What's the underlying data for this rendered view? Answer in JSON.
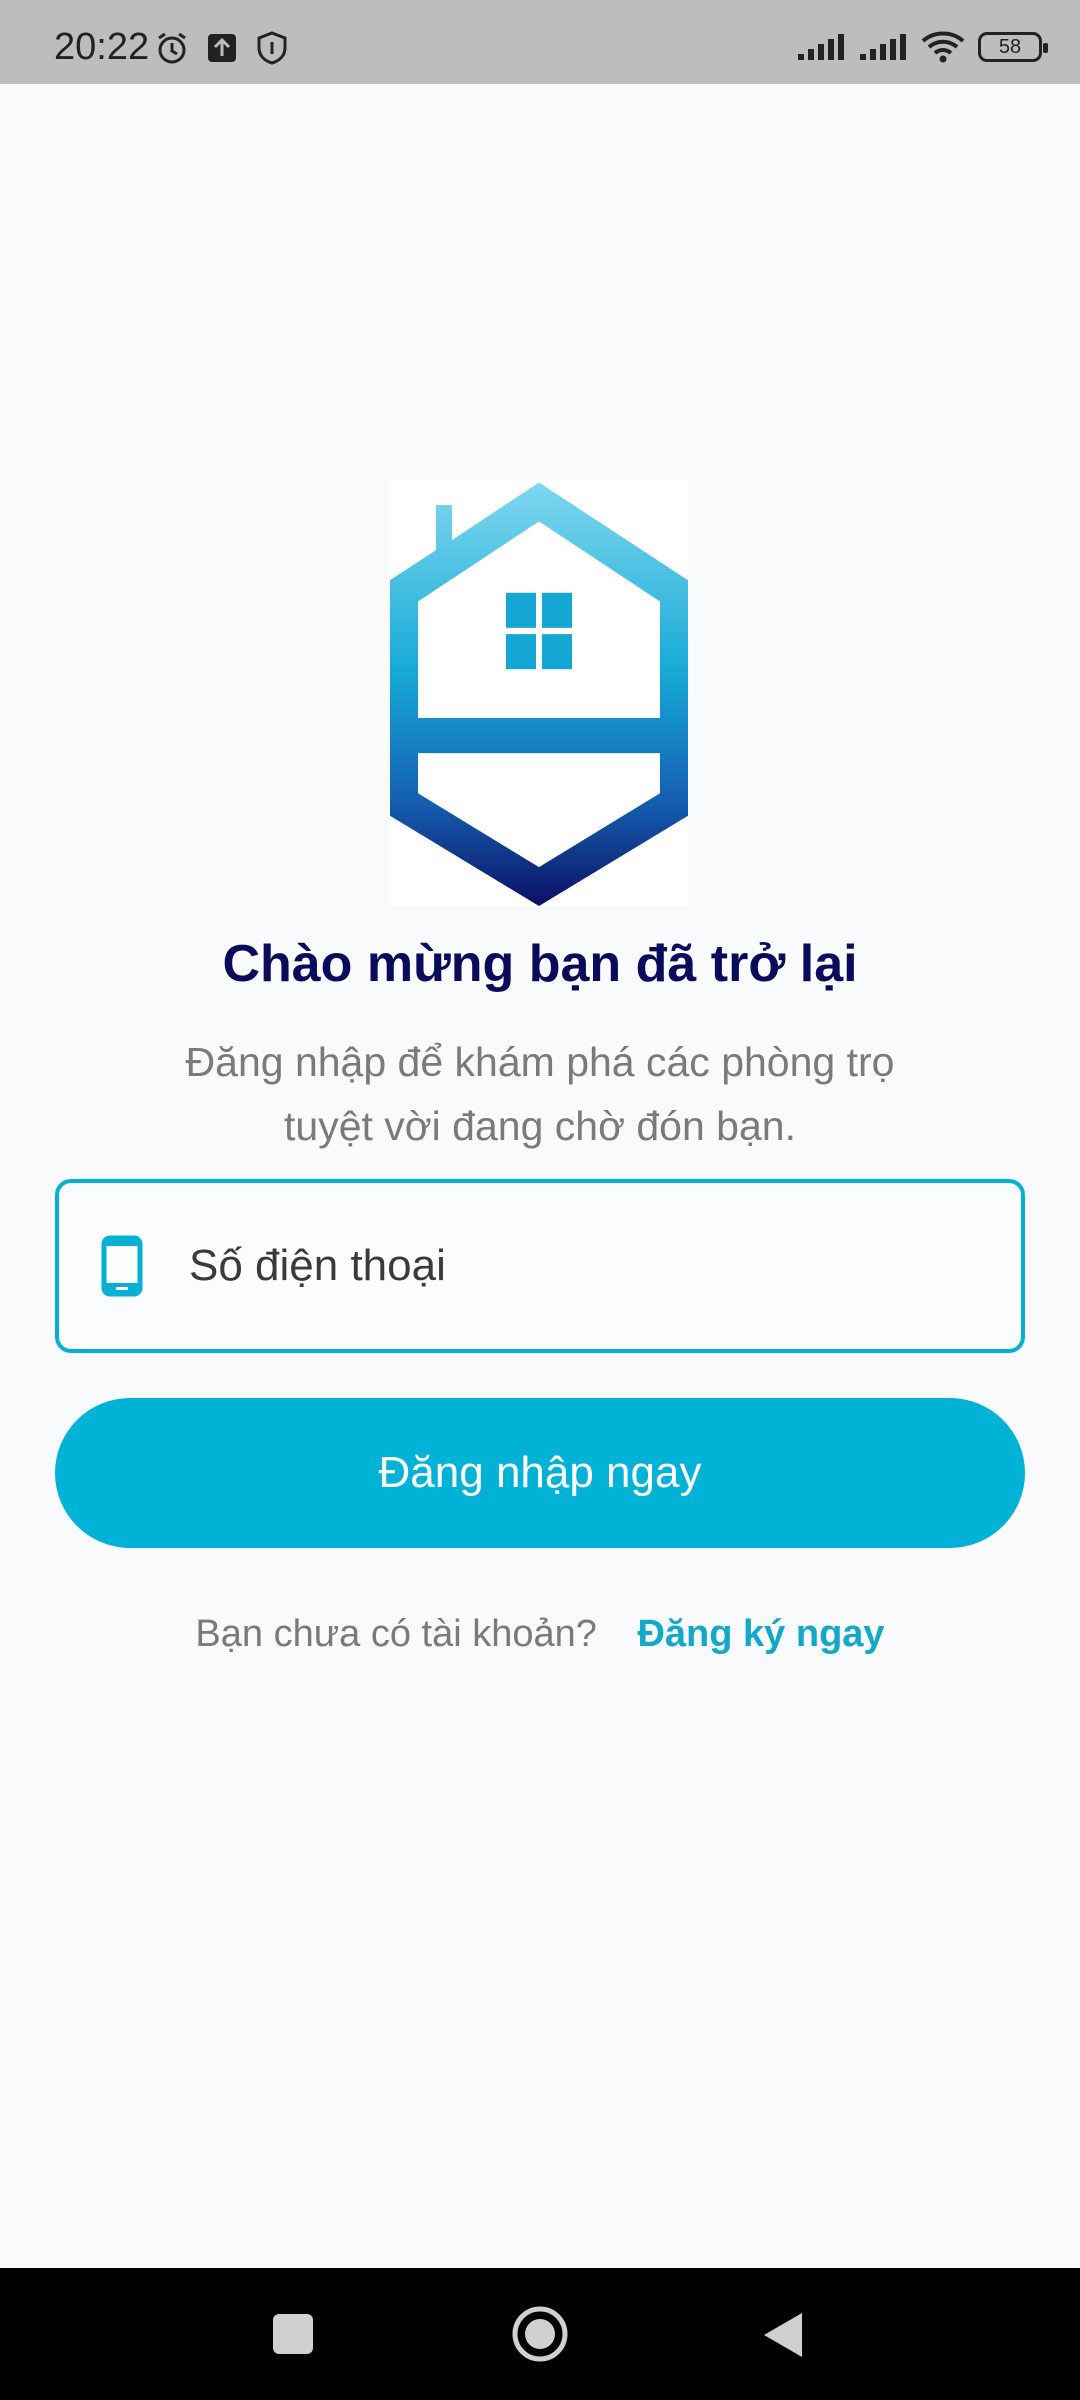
{
  "status_bar": {
    "time": "20:22",
    "battery": "58",
    "left_icons": [
      "alarm-icon",
      "upload-icon",
      "shield-icon"
    ],
    "right_icons": [
      "signal-icon",
      "signal-icon",
      "wifi-icon",
      "battery-icon"
    ]
  },
  "logo": {
    "icon": "house-s-logo"
  },
  "welcome": {
    "title": "Chào mừng bạn đã trở lại",
    "subtitle_line1": "Đăng nhập để khám phá các phòng trọ",
    "subtitle_line2": "tuyệt vời đang chờ đón bạn."
  },
  "phone_input": {
    "placeholder": "Số điện thoại",
    "value": "",
    "icon": "smartphone-icon"
  },
  "login_button": {
    "label": "Đăng nhập ngay"
  },
  "register": {
    "prompt": "Bạn chưa có tài khoản?",
    "link_label": "Đăng ký ngay"
  },
  "colors": {
    "accent": "#00b2d6",
    "title": "#0b0b5c",
    "muted_text": "#7a7a7a",
    "background": "#f8fafc"
  },
  "nav_bar": {
    "buttons": [
      "recents-icon",
      "home-icon",
      "back-icon"
    ]
  }
}
